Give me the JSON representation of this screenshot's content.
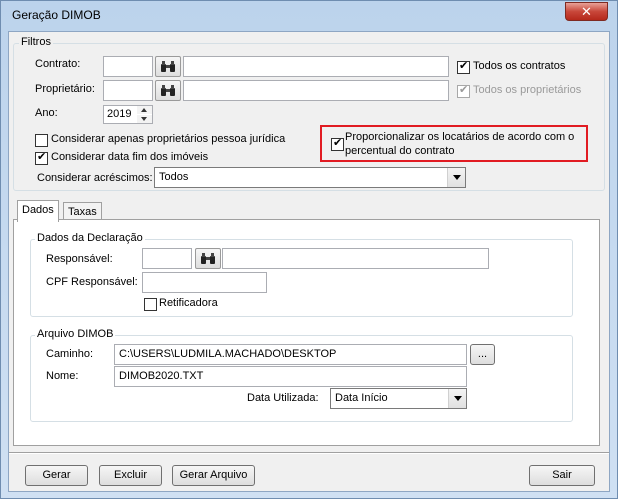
{
  "window": {
    "title": "Geração DIMOB",
    "close_label": "✕"
  },
  "filtros": {
    "legend": "Filtros",
    "contrato_label": "Contrato:",
    "contrato_code": "",
    "contrato_desc": "",
    "todos_contratos_label": "Todos os contratos",
    "todos_contratos_checked": true,
    "proprietario_label": "Proprietário:",
    "proprietario_code": "",
    "proprietario_desc": "",
    "todos_proprietarios_label": "Todos os proprietários",
    "todos_proprietarios_checked": true,
    "ano_label": "Ano:",
    "ano_value": "2019",
    "pessoa_juridica_label": "Considerar apenas proprietários pessoa jurídica",
    "pessoa_juridica_checked": false,
    "data_fim_label": "Considerar data fim dos imóveis",
    "data_fim_checked": true,
    "proporcionalizar_label_line1": "Proporcionalizar os locatários de acordo com o",
    "proporcionalizar_label_line2": "percentual do contrato",
    "proporcionalizar_checked": true,
    "acrescimos_label": "Considerar acréscimos:",
    "acrescimos_value": "Todos",
    "highlight_color": "#e11b22"
  },
  "tabs": [
    {
      "label": "Dados"
    },
    {
      "label": "Taxas"
    }
  ],
  "dados_declaracao": {
    "legend": "Dados da Declaração",
    "responsavel_label": "Responsável:",
    "responsavel_code": "",
    "responsavel_desc": "",
    "cpf_label": "CPF Responsável:",
    "cpf_value": "",
    "retificadora_label": "Retificadora",
    "retificadora_checked": false
  },
  "arquivo": {
    "legend": "Arquivo DIMOB",
    "caminho_label": "Caminho:",
    "caminho_value": "C:\\USERS\\LUDMILA.MACHADO\\DESKTOP",
    "browse_label": "...",
    "nome_label": "Nome:",
    "nome_value": "DIMOB2020.TXT",
    "data_utilizada_label": "Data Utilizada:",
    "data_utilizada_value": "Data Início"
  },
  "footer": {
    "gerar": "Gerar",
    "excluir": "Excluir",
    "gerar_arquivo": "Gerar Arquivo",
    "sair": "Sair"
  },
  "icons": {
    "search": "binoculars-icon",
    "check": "✔"
  }
}
